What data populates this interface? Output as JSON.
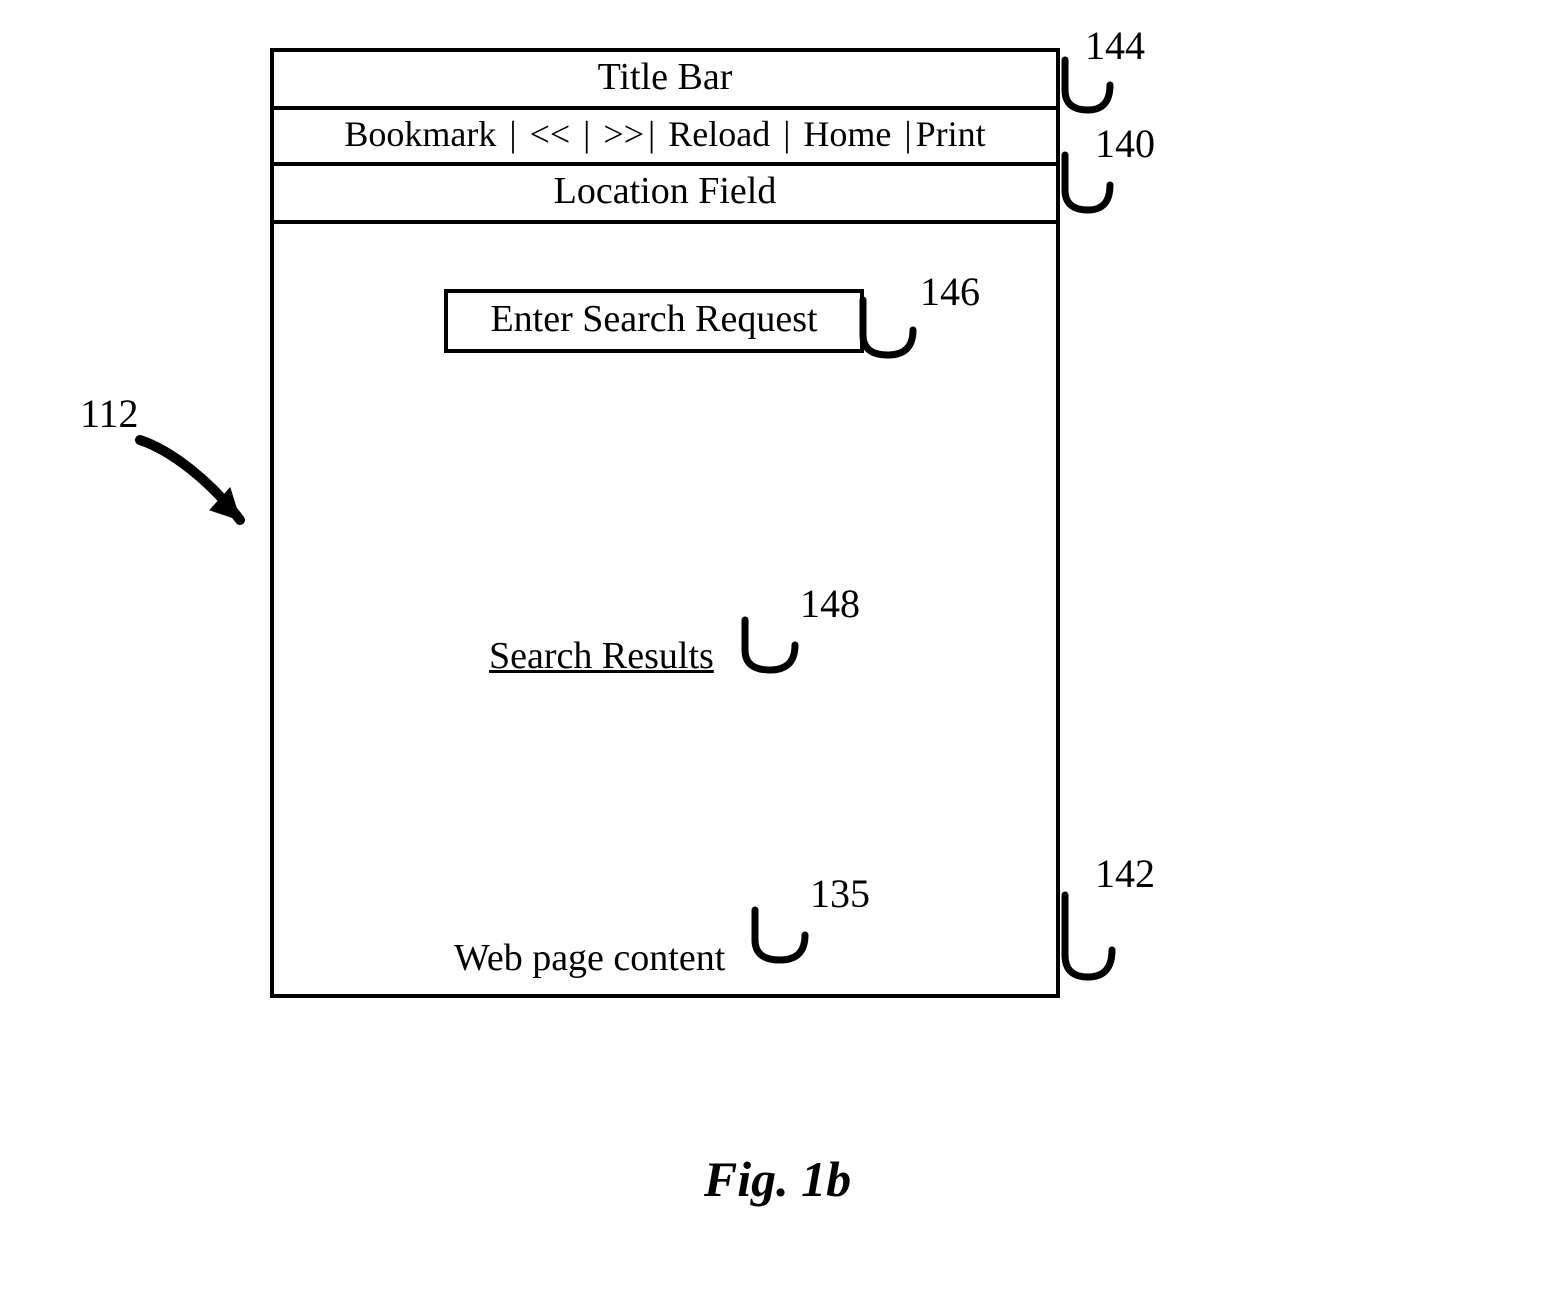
{
  "figure_caption": "Fig. 1b",
  "refs": {
    "window": "112",
    "title_bar": "144",
    "toolbar": "140",
    "content": "142",
    "search_box": "146",
    "results": "148",
    "webpage": "135"
  },
  "title_bar": "Title Bar",
  "toolbar": {
    "bookmark": "Bookmark",
    "back": "<<",
    "forward": ">>",
    "reload": "Reload",
    "home": "Home",
    "print": "Print",
    "sep": "|"
  },
  "location_field": "Location Field",
  "search_placeholder": "Enter Search Request",
  "results_label": "Search Results",
  "content_label": "Web page content"
}
